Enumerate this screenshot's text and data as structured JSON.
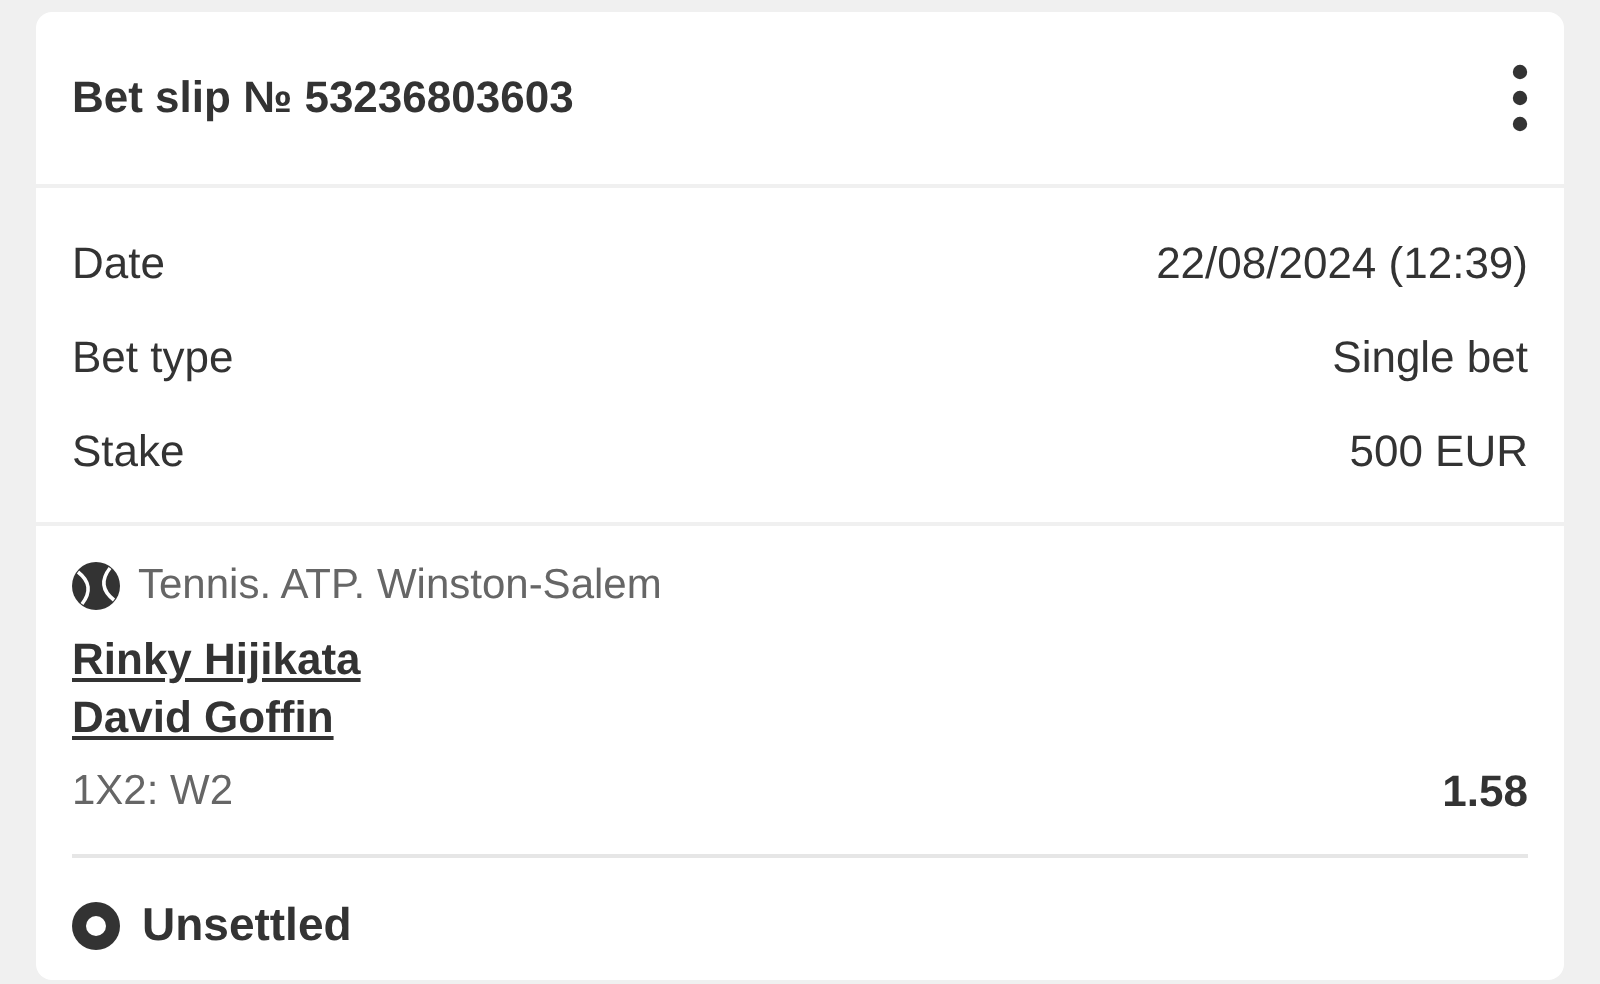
{
  "header": {
    "title": "Bet slip № 53236803603"
  },
  "details": [
    {
      "label": "Date",
      "value": "22/08/2024 (12:39)"
    },
    {
      "label": "Bet type",
      "value": "Single bet"
    },
    {
      "label": "Stake",
      "value": "500 EUR"
    }
  ],
  "event": {
    "sport": "Tennis. ATP. Winston-Salem",
    "teams": [
      "Rinky Hijikata",
      "David Goffin"
    ],
    "market": "1X2: W2",
    "odds": "1.58"
  },
  "status": {
    "kind": "unsettled",
    "label": "Unsettled"
  }
}
